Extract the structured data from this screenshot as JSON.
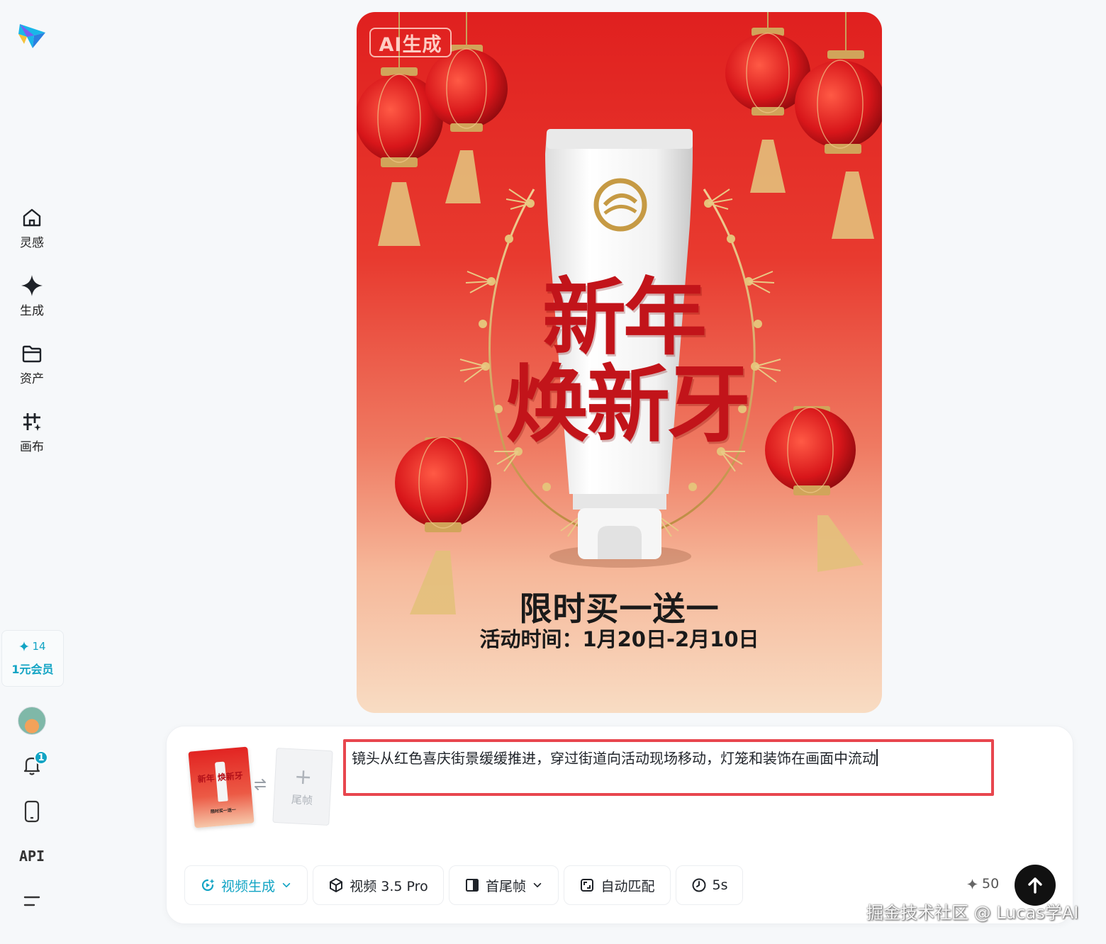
{
  "sidebar": {
    "nav": [
      {
        "label": "灵感",
        "icon": "home-icon"
      },
      {
        "label": "生成",
        "icon": "sparkle-icon"
      },
      {
        "label": "资产",
        "icon": "folder-icon"
      },
      {
        "label": "画布",
        "icon": "canvas-icon"
      }
    ],
    "member": {
      "credits": "14",
      "label": "1元会员"
    },
    "notification_count": "1",
    "api_label": "API"
  },
  "poster": {
    "ai_badge": "AI生成",
    "headline_line1": "新年",
    "headline_line2": "焕新牙",
    "promo_title": "限时买一送一",
    "promo_date": "活动时间：1月20日-2月10日"
  },
  "composer": {
    "first_frame_thumb": {
      "headline": "新年 焕新牙",
      "sub": "限时买一送一"
    },
    "last_frame_label": "尾帧",
    "prompt_text": "镜头从红色喜庆街景缓缓推进，穿过街道向活动现场移动，灯笼和装饰在画面中流动",
    "toolbar": {
      "mode": "视频生成",
      "model": "视频 3.5 Pro",
      "frame_mode": "首尾帧",
      "ratio": "自动匹配",
      "duration": "5s"
    },
    "cost": "50"
  },
  "watermark": "掘金技术社区 @ Lucas学AI",
  "colors": {
    "accent": "#12a4c4",
    "highlight_border": "#e8464e",
    "send_button": "#111111"
  }
}
